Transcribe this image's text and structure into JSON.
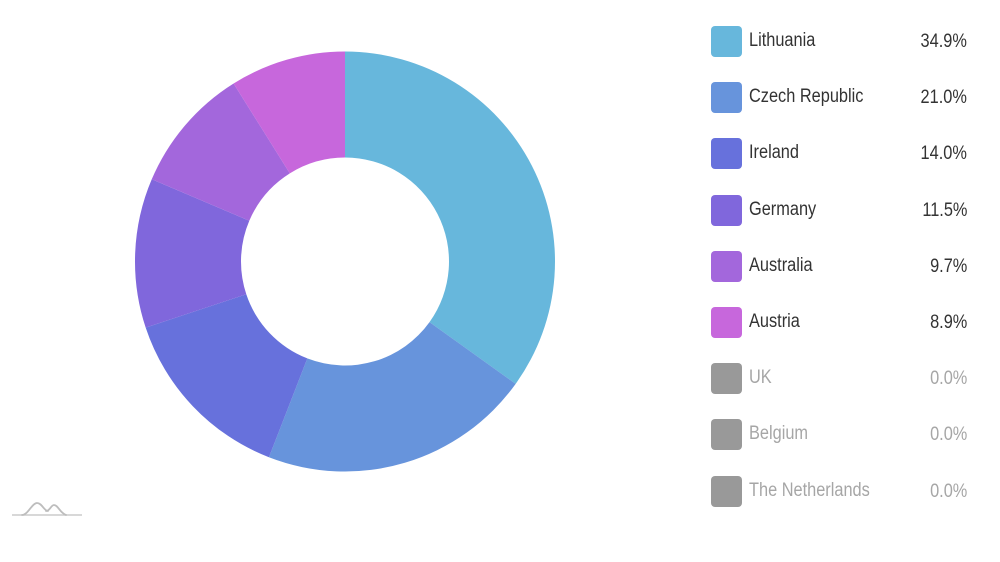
{
  "chart_data": {
    "type": "pie",
    "variant": "donut",
    "title": "",
    "start_angle": "top",
    "direction": "clockwise",
    "slices": [
      {
        "label": "Lithuania",
        "percent": 34.9,
        "percent_label": "34.9%",
        "color": "#67b7dc",
        "enabled": true
      },
      {
        "label": "Czech Republic",
        "percent": 21.0,
        "percent_label": "21.0%",
        "color": "#6794dc",
        "enabled": true
      },
      {
        "label": "Ireland",
        "percent": 14.0,
        "percent_label": "14.0%",
        "color": "#6771dc",
        "enabled": true
      },
      {
        "label": "Germany",
        "percent": 11.5,
        "percent_label": "11.5%",
        "color": "#8067dc",
        "enabled": true
      },
      {
        "label": "Australia",
        "percent": 9.7,
        "percent_label": "9.7%",
        "color": "#a367dc",
        "enabled": true
      },
      {
        "label": "Austria",
        "percent": 8.9,
        "percent_label": "8.9%",
        "color": "#c767dc",
        "enabled": true
      },
      {
        "label": "UK",
        "percent": 0.0,
        "percent_label": "0.0%",
        "color": "#999999",
        "enabled": false
      },
      {
        "label": "Belgium",
        "percent": 0.0,
        "percent_label": "0.0%",
        "color": "#999999",
        "enabled": false
      },
      {
        "label": "The Netherlands",
        "percent": 0.0,
        "percent_label": "0.0%",
        "color": "#999999",
        "enabled": false
      }
    ],
    "legend": {
      "position": "right",
      "show_values": true
    }
  },
  "logo": {
    "icon": "amcharts-logo-icon"
  }
}
